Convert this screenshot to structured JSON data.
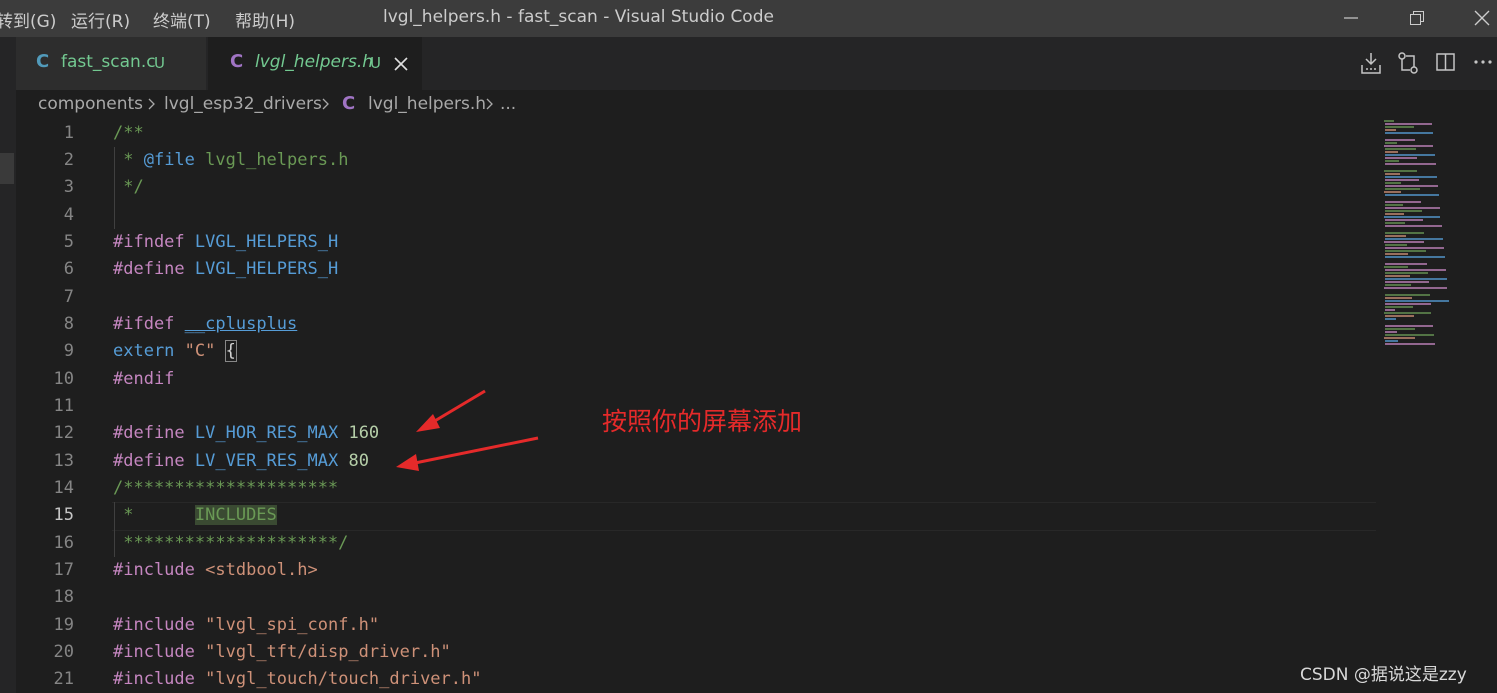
{
  "titlebar": {
    "menu": [
      "转到(G)",
      "运行(R)",
      "终端(T)",
      "帮助(H)"
    ],
    "title": "lvgl_helpers.h - fast_scan - Visual Studio Code"
  },
  "tabs": [
    {
      "icon": "C",
      "name": "fast_scan.c",
      "status": "U",
      "active": false
    },
    {
      "icon": "C",
      "name": "lvgl_helpers.h",
      "status": "U",
      "active": true
    }
  ],
  "breadcrumb": {
    "items": [
      "components",
      "lvgl_esp32_drivers",
      "lvgl_helpers.h",
      "..."
    ],
    "file_icon": "C"
  },
  "editor": {
    "active_line": 15,
    "line_numbers": [
      "1",
      "2",
      "3",
      "4",
      "5",
      "6",
      "7",
      "8",
      "9",
      "10",
      "11",
      "12",
      "13",
      "14",
      "15",
      "16",
      "17",
      "18",
      "19",
      "20",
      "21"
    ]
  },
  "annotation": {
    "text": "按照你的屏幕添加"
  },
  "watermark": "CSDN @据说这是zzy",
  "colors": {
    "accent_tab_text": "#73c991",
    "c_file_icon": "#a074c4",
    "annotation": "#e52a2a"
  }
}
